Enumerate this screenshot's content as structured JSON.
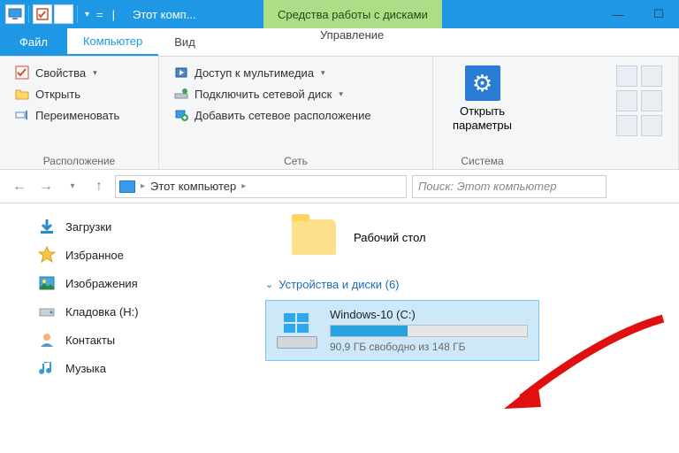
{
  "titlebar": {
    "window_title": "Этот комп...",
    "context_tab": "Средства работы с дисками"
  },
  "tabs": {
    "file": "Файл",
    "computer": "Компьютер",
    "view": "Вид",
    "manage": "Управление"
  },
  "ribbon": {
    "properties": "Свойства",
    "open": "Открыть",
    "rename": "Переименовать",
    "group_location": "Расположение",
    "media_access": "Доступ к мультимедиа",
    "map_drive": "Подключить сетевой диск",
    "add_location": "Добавить сетевое расположение",
    "group_network": "Сеть",
    "open_params": "Открыть",
    "open_params2": "параметры",
    "group_system": "Система"
  },
  "nav": {
    "breadcrumb_root": "Этот компьютер",
    "search_placeholder": "Поиск: Этот компьютер"
  },
  "tree": {
    "downloads": "Загрузки",
    "favorites": "Избранное",
    "pictures": "Изображения",
    "storage": "Кладовка (H:)",
    "contacts": "Контакты",
    "music": "Музыка"
  },
  "main": {
    "desktop": "Рабочий стол",
    "devices_header": "Устройства и диски (6)",
    "drive_name": "Windows-10 (C:)",
    "drive_free": "90,9 ГБ свободно из 148 ГБ",
    "drive_used_percent": 39
  }
}
